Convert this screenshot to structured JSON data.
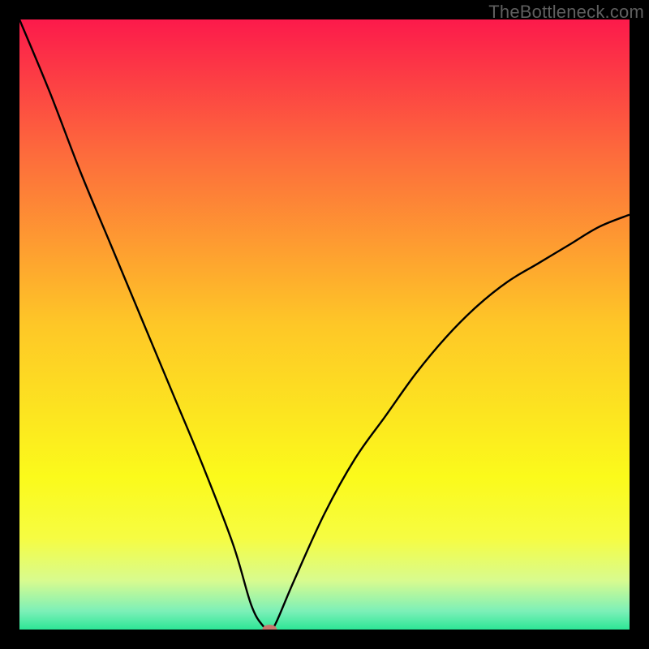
{
  "watermark": "TheBottleneck.com",
  "chart_data": {
    "type": "line",
    "title": "",
    "xlabel": "",
    "ylabel": "",
    "xlim": [
      0,
      100
    ],
    "ylim": [
      0,
      100
    ],
    "grid": false,
    "legend": false,
    "background": "red-yellow-green vertical gradient",
    "series": [
      {
        "name": "bottleneck-curve",
        "x": [
          0,
          5,
          10,
          15,
          20,
          25,
          30,
          35,
          38,
          40,
          41,
          42,
          45,
          50,
          55,
          60,
          65,
          70,
          75,
          80,
          85,
          90,
          95,
          100
        ],
        "y": [
          100,
          88,
          75,
          63,
          51,
          39,
          27,
          14,
          4,
          0.5,
          0,
          1,
          8,
          19,
          28,
          35,
          42,
          48,
          53,
          57,
          60,
          63,
          66,
          68
        ]
      }
    ],
    "marker": {
      "name": "optimum-point",
      "x": 41,
      "y": 0,
      "color": "#c7786d"
    },
    "gradient_stops": [
      {
        "offset": 0,
        "color": "#fc1a4b"
      },
      {
        "offset": 22,
        "color": "#fd6b3c"
      },
      {
        "offset": 50,
        "color": "#fec727"
      },
      {
        "offset": 75,
        "color": "#fbfa1b"
      },
      {
        "offset": 85,
        "color": "#f6fc42"
      },
      {
        "offset": 92,
        "color": "#d8fb8f"
      },
      {
        "offset": 97,
        "color": "#7cf0b8"
      },
      {
        "offset": 100,
        "color": "#2de696"
      }
    ]
  }
}
